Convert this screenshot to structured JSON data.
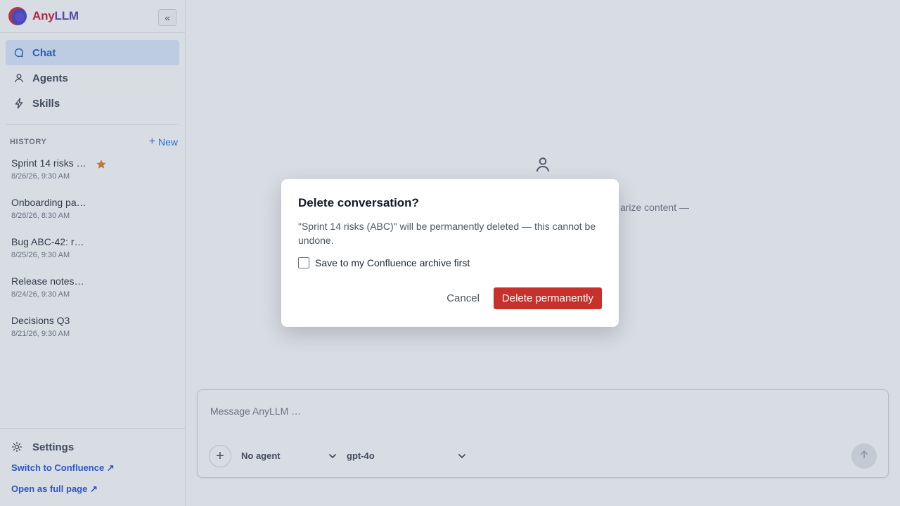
{
  "app": {
    "name_part1": "Any",
    "name_part2": "LLM",
    "collapse_label": "«"
  },
  "nav": {
    "items": [
      {
        "label": "Chat",
        "icon": "chat-bubble-icon",
        "active": true
      },
      {
        "label": "Agents",
        "icon": "person-icon",
        "active": false
      },
      {
        "label": "Skills",
        "icon": "lightning-icon",
        "active": false
      }
    ]
  },
  "history": {
    "title": "HISTORY",
    "new_label": "New",
    "items": [
      {
        "title": "Sprint 14 risks …",
        "date": "8/26/26, 9:30 AM",
        "starred": true
      },
      {
        "title": "Onboarding pa…",
        "date": "8/26/26, 8:30 AM",
        "starred": false
      },
      {
        "title": "Bug ABC-42: r…",
        "date": "8/25/26, 9:30 AM",
        "starred": false
      },
      {
        "title": "Release notes…",
        "date": "8/24/26, 9:30 AM",
        "starred": false
      },
      {
        "title": "Decisions Q3",
        "date": "8/21/26, 9:30 AM",
        "starred": false
      }
    ]
  },
  "footer": {
    "settings_label": "Settings",
    "switch_link": "Switch to Confluence ↗",
    "open_full_link": "Open as full page ↗"
  },
  "main": {
    "hero_text": "arize content —"
  },
  "composer": {
    "placeholder": "Message AnyLLM …",
    "agent_select": "No agent",
    "model_select": "gpt-4o"
  },
  "dialog": {
    "title": "Delete conversation?",
    "message": "\"Sprint 14 risks (ABC)\" will be permanently deleted — this cannot be undone.",
    "checkbox_label": "Save to my Confluence archive first",
    "checkbox_checked": false,
    "cancel_label": "Cancel",
    "delete_label": "Delete permanently"
  },
  "colors": {
    "accent": "#1a73e8",
    "danger": "#c8302b",
    "star": "#e07a12"
  }
}
